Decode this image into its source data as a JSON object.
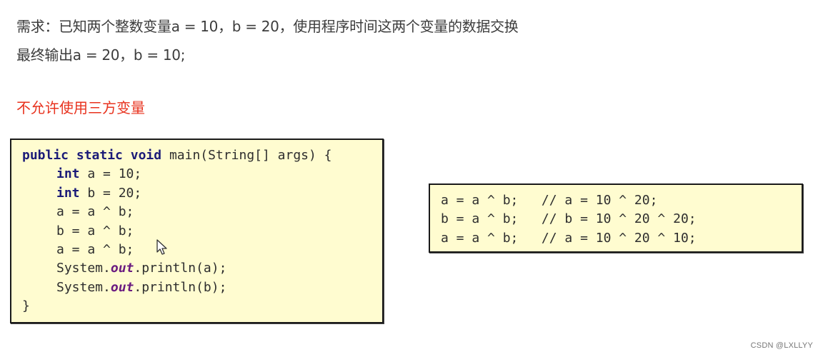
{
  "requirement": {
    "line1": "需求：已知两个整数变量a = 10，b = 20，使用程序时间这两个变量的数据交换",
    "line2": "最终输出a = 20，b = 10;",
    "constraint": "不允许使用三方变量"
  },
  "main_code": {
    "signature": {
      "kw_public": "public",
      "kw_static": "static",
      "kw_void": "void",
      "rest": " main(String[] args) {"
    },
    "decl_a": {
      "kw": "int",
      "rest": " a = 10;"
    },
    "decl_b": {
      "kw": "int",
      "rest": " b = 20;"
    },
    "stmt1": "a = a ^ b;",
    "stmt2": "b = a ^ b;",
    "stmt3": "a = a ^ b;",
    "print_a": {
      "prefix": "System.",
      "field": "out",
      "suffix": ".println(a);"
    },
    "print_b": {
      "prefix": "System.",
      "field": "out",
      "suffix": ".println(b);"
    },
    "closing": "}"
  },
  "xor_code": {
    "lines": [
      "a = a ^ b;   // a = 10 ^ 20;",
      "b = a ^ b;   // b = 10 ^ 20 ^ 20;",
      "a = a ^ b;   // a = 10 ^ 20 ^ 10;"
    ]
  },
  "watermark": "CSDN @LXLLYY",
  "colors": {
    "constraint_text": "#e8321e",
    "code_background": "#fffcd0",
    "keyword": "#1b1b78",
    "field": "#6a1b80"
  },
  "icons": {
    "cursor": "mouse-pointer-icon"
  }
}
